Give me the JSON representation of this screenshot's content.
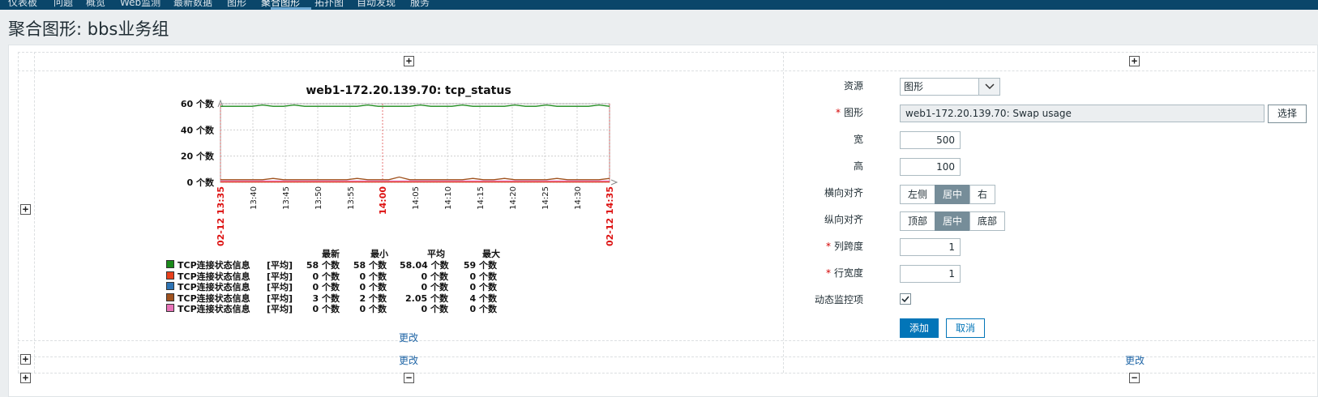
{
  "nav": {
    "items": [
      "仪表板",
      "问题",
      "概览",
      "Web监测",
      "最新数据",
      "图形",
      "聚合图形",
      "拓扑图",
      "自动发现",
      "服务"
    ],
    "active_index": 6
  },
  "page": {
    "title": "聚合图形: bbs业务组"
  },
  "grid": {
    "add_symbol": "+",
    "remove_symbol": "−",
    "change_link": "更改"
  },
  "chart_data": {
    "type": "line",
    "title": "web1-172.20.139.70: tcp_status",
    "ylim": [
      0,
      60
    ],
    "yticks": [
      "60 个数",
      "40 个数",
      "20 个数",
      "0 个数"
    ],
    "xticks": [
      "02-12 13:35",
      "13:40",
      "13:45",
      "13:50",
      "13:55",
      "14:00",
      "14:05",
      "14:10",
      "14:15",
      "14:20",
      "14:25",
      "14:30",
      "02-12 14:35"
    ],
    "x_highlight": [
      "02-12 13:35",
      "14:00",
      "02-12 14:35"
    ],
    "grid": true,
    "series": [
      {
        "name": "TCP连接状态信息",
        "color": "#1a8a1a",
        "values": [
          58,
          58,
          58,
          58,
          59,
          58,
          58,
          59,
          58,
          58,
          58,
          58,
          58,
          58,
          59,
          58,
          58,
          58,
          58,
          59,
          58,
          58,
          58,
          59,
          58,
          58,
          58,
          58,
          59,
          58,
          58,
          59,
          58,
          58,
          58,
          58,
          59,
          58
        ]
      },
      {
        "name": "TCP连接状态信息",
        "color": "#e8401c",
        "values": [
          0,
          0,
          0,
          0,
          0,
          0,
          0,
          0,
          0,
          0,
          0,
          0,
          0,
          0,
          0,
          0,
          0,
          0,
          0,
          0,
          0,
          0,
          0,
          0,
          0,
          0,
          0,
          0,
          0,
          0,
          0,
          0,
          0,
          0,
          0,
          0,
          0,
          0
        ]
      },
      {
        "name": "TCP连接状态信息",
        "color": "#2e74b5",
        "values": [
          0,
          0,
          0,
          0,
          0,
          0,
          0,
          0,
          0,
          0,
          0,
          0,
          0,
          0,
          0,
          0,
          0,
          0,
          0,
          0,
          0,
          0,
          0,
          0,
          0,
          0,
          0,
          0,
          0,
          0,
          0,
          0,
          0,
          0,
          0,
          0,
          0,
          0
        ]
      },
      {
        "name": "TCP连接状态信息",
        "color": "#a0521e",
        "values": [
          2,
          2,
          2,
          2,
          2,
          3,
          2,
          2,
          2,
          2,
          2,
          2,
          2,
          3,
          2,
          2,
          2,
          4,
          2,
          2,
          2,
          2,
          2,
          2,
          3,
          2,
          2,
          3,
          2,
          2,
          2,
          2,
          3,
          2,
          2,
          2,
          2,
          3
        ]
      },
      {
        "name": "TCP连接状态信息",
        "color": "#e873b8",
        "values": [
          0,
          0,
          0,
          0,
          0,
          0,
          0,
          0,
          0,
          0,
          0,
          0,
          0,
          0,
          0,
          0,
          0,
          0,
          0,
          0,
          0,
          0,
          0,
          0,
          0,
          0,
          0,
          0,
          0,
          0,
          0,
          0,
          0,
          0,
          0,
          0,
          0,
          0
        ]
      }
    ]
  },
  "legend": {
    "headers": [
      "最新",
      "最小",
      "平均",
      "最大"
    ],
    "rows": [
      {
        "color": "#1a8a1a",
        "name": "TCP连接状态信息",
        "func": "[平均]",
        "last": "58 个数",
        "min": "58 个数",
        "avg": "58.04 个数",
        "max": "59 个数"
      },
      {
        "color": "#e8401c",
        "name": "TCP连接状态信息",
        "func": "[平均]",
        "last": "0 个数",
        "min": "0 个数",
        "avg": "0 个数",
        "max": "0 个数"
      },
      {
        "color": "#2e74b5",
        "name": "TCP连接状态信息",
        "func": "[平均]",
        "last": "0 个数",
        "min": "0 个数",
        "avg": "0 个数",
        "max": "0 个数"
      },
      {
        "color": "#a0521e",
        "name": "TCP连接状态信息",
        "func": "[平均]",
        "last": "3 个数",
        "min": "2 个数",
        "avg": "2.05 个数",
        "max": "4 个数"
      },
      {
        "color": "#e873b8",
        "name": "TCP连接状态信息",
        "func": "[平均]",
        "last": "0 个数",
        "min": "0 个数",
        "avg": "0 个数",
        "max": "0 个数"
      }
    ]
  },
  "form": {
    "resource_label": "资源",
    "resource_value": "图形",
    "graph_label": "图形",
    "graph_value": "web1-172.20.139.70: Swap usage",
    "select_button": "选择",
    "width_label": "宽",
    "width_value": "500",
    "height_label": "高",
    "height_value": "100",
    "halign_label": "横向对齐",
    "halign_options": [
      "左侧",
      "居中",
      "右"
    ],
    "halign_selected": "居中",
    "valign_label": "纵向对齐",
    "valign_options": [
      "顶部",
      "居中",
      "底部"
    ],
    "valign_selected": "居中",
    "colspan_label": "列跨度",
    "colspan_value": "1",
    "rowspan_label": "行宽度",
    "rowspan_value": "1",
    "dynamic_label": "动态监控项",
    "dynamic_checked": true,
    "add_button": "添加",
    "cancel_button": "取消"
  }
}
